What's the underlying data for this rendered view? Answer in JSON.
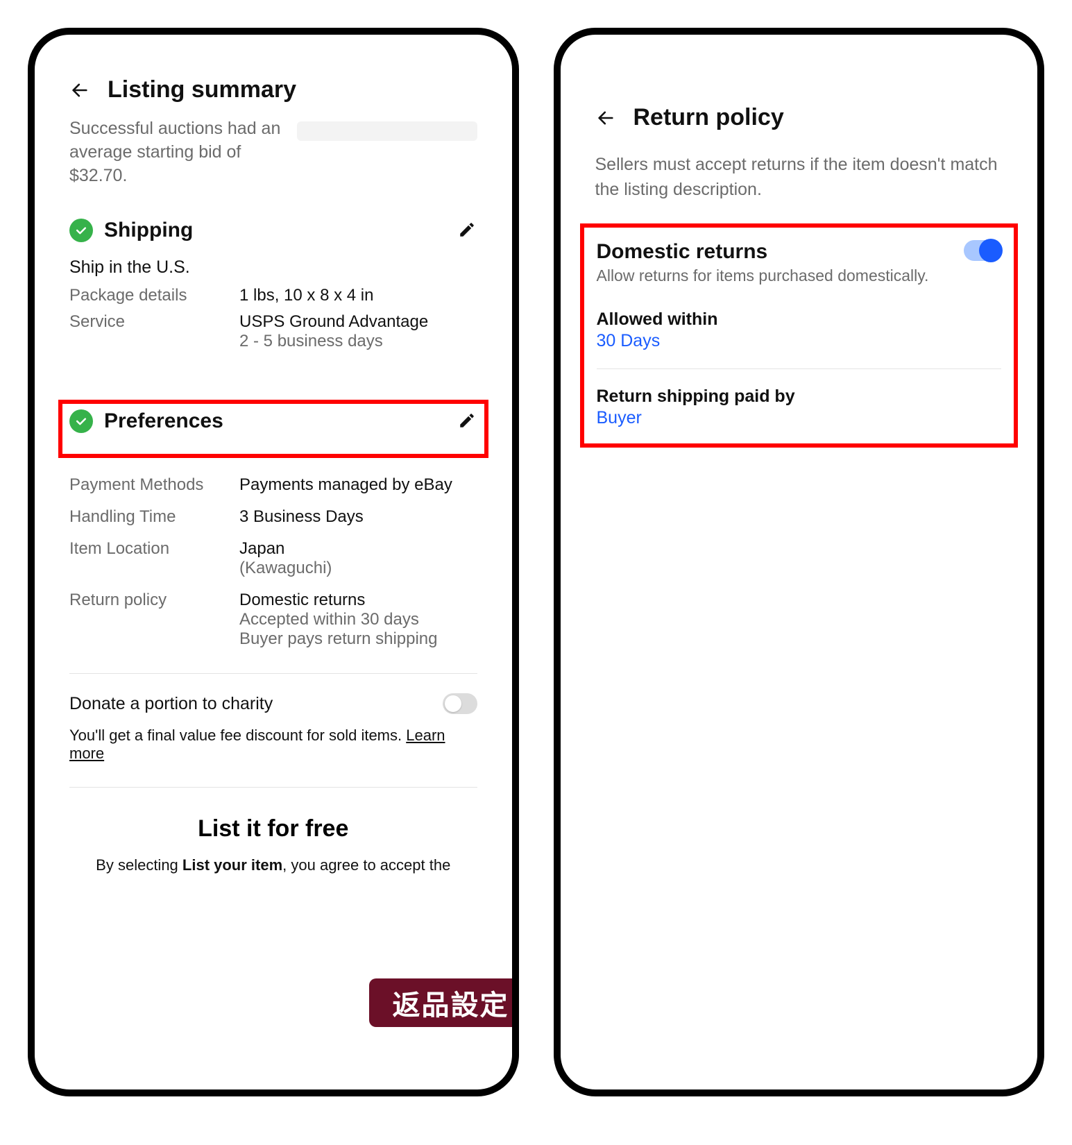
{
  "left": {
    "title": "Listing summary",
    "subtext": "Successful auctions had an average starting bid of $32.70.",
    "shipping": {
      "heading": "Shipping",
      "ship_in": "Ship in the U.S.",
      "pkg_label": "Package details",
      "pkg_val": "1 lbs, 10 x 8 x 4 in",
      "svc_label": "Service",
      "svc_val": "USPS Ground Advantage",
      "svc_sub": "2 - 5 business days"
    },
    "prefs": {
      "heading": "Preferences",
      "pay_label": "Payment Methods",
      "pay_val": "Payments managed by eBay",
      "hand_label": "Handling Time",
      "hand_val": "3 Business Days",
      "loc_label": "Item Location",
      "loc_val": "Japan",
      "loc_sub": "(Kawaguchi)",
      "ret_label": "Return policy",
      "ret_val": "Domestic returns",
      "ret_sub1": "Accepted within 30 days",
      "ret_sub2": "Buyer pays return shipping"
    },
    "charity": {
      "label": "Donate a portion to charity",
      "note_pre": "You'll get a final value fee discount for sold items. ",
      "learn": "Learn more"
    },
    "list_free": "List it for free",
    "agree_pre": "By selecting ",
    "agree_bold": "List your item",
    "agree_post": ", you agree to accept the"
  },
  "right": {
    "title": "Return policy",
    "note": "Sellers must accept returns if the item doesn't match the listing description.",
    "dom_title": "Domestic returns",
    "dom_sub": "Allow returns for items purchased domestically.",
    "allowed_label": "Allowed within",
    "allowed_val": "30 Days",
    "paid_label": "Return shipping paid by",
    "paid_val": "Buyer"
  },
  "badge": "返品設定"
}
